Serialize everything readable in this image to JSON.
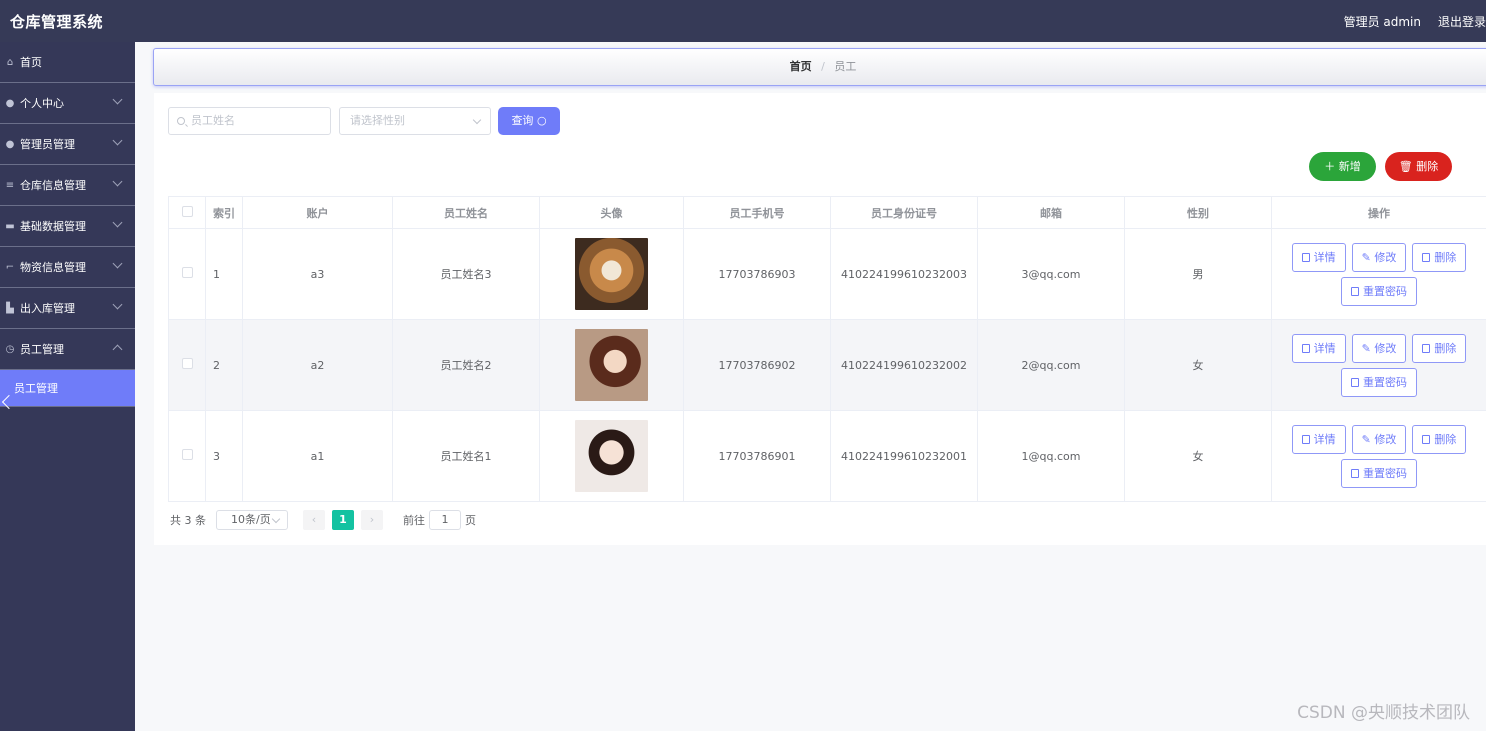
{
  "app": {
    "title": "仓库管理系统"
  },
  "header": {
    "admin_label": "管理员 admin",
    "logout_label": "退出登录"
  },
  "sidebar": {
    "items": [
      {
        "label": "首页",
        "icon": "home-icon"
      },
      {
        "label": "个人中心",
        "icon": "user-icon"
      },
      {
        "label": "管理员管理",
        "icon": "user-icon"
      },
      {
        "label": "仓库信息管理",
        "icon": "list-icon"
      },
      {
        "label": "基础数据管理",
        "icon": "chat-icon"
      },
      {
        "label": "物资信息管理",
        "icon": "crop-icon"
      },
      {
        "label": "出入库管理",
        "icon": "thumb-icon"
      },
      {
        "label": "员工管理",
        "icon": "clock-icon"
      }
    ],
    "active_sub": "员工管理"
  },
  "breadcrumb": {
    "home": "首页",
    "separator": "/",
    "current": "员工"
  },
  "filters": {
    "name_placeholder": "员工姓名",
    "gender_placeholder": "请选择性别",
    "query_label": "查询"
  },
  "actions": {
    "add_label": "新增",
    "delete_label": "删除"
  },
  "table": {
    "headers": [
      "索引",
      "账户",
      "员工姓名",
      "头像",
      "员工手机号",
      "员工身份证号",
      "邮箱",
      "性别",
      "操作"
    ],
    "rows": [
      {
        "index": "1",
        "account": "a3",
        "name": "员工姓名3",
        "phone": "17703786903",
        "id_card": "410224199610232003",
        "email": "3@qq.com",
        "gender": "男"
      },
      {
        "index": "2",
        "account": "a2",
        "name": "员工姓名2",
        "phone": "17703786902",
        "id_card": "410224199610232002",
        "email": "2@qq.com",
        "gender": "女"
      },
      {
        "index": "3",
        "account": "a1",
        "name": "员工姓名1",
        "phone": "17703786901",
        "id_card": "410224199610232001",
        "email": "1@qq.com",
        "gender": "女"
      }
    ],
    "row_actions": {
      "detail": "详情",
      "edit": "修改",
      "delete": "删除",
      "reset": "重置密码"
    }
  },
  "pagination": {
    "total": "共 3 条",
    "page_size": "10条/页",
    "current_page": "1",
    "goto_prefix": "前往",
    "goto_value": "1",
    "goto_suffix": "页",
    "prev": "‹",
    "next": "›"
  },
  "watermark": "CSDN @央顺技术团队",
  "colors": {
    "sidebar": "#353858",
    "accent": "#6f7cf9",
    "add": "#2ba53a",
    "delete": "#d9231e",
    "page_active": "#13c2a1"
  }
}
